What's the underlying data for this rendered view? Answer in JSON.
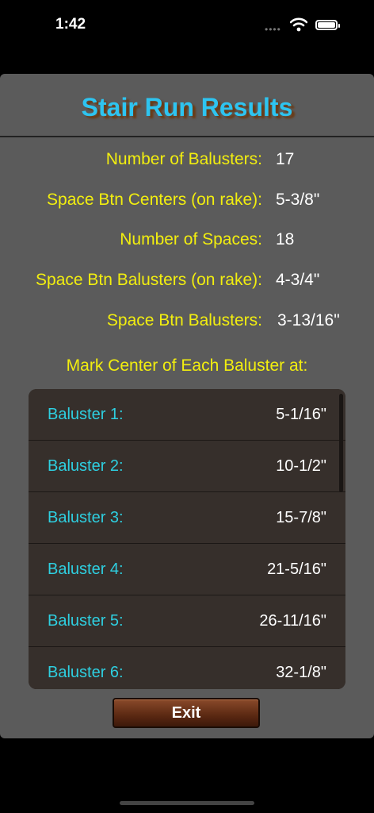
{
  "status_bar": {
    "time": "1:42",
    "dots": "••••"
  },
  "title": "Stair Run Results",
  "results": [
    {
      "label": "Number of Balusters:",
      "value": "17"
    },
    {
      "label": "Space Btn Centers (on rake):",
      "value": "5-3/8\""
    },
    {
      "label": "Number of Spaces:",
      "value": "18"
    },
    {
      "label": "Space Btn Balusters (on rake):",
      "value": "4-3/4\""
    },
    {
      "label": "Space Btn Balusters:",
      "value": "3-13/16\""
    }
  ],
  "mark_heading": "Mark Center of Each Baluster at:",
  "balusters": [
    {
      "name": "Baluster 1:",
      "value": "5-1/16\""
    },
    {
      "name": "Baluster 2:",
      "value": "10-1/2\""
    },
    {
      "name": "Baluster 3:",
      "value": "15-7/8\""
    },
    {
      "name": "Baluster 4:",
      "value": "21-5/16\""
    },
    {
      "name": "Baluster 5:",
      "value": "26-11/16\""
    },
    {
      "name": "Baluster 6:",
      "value": "32-1/8\""
    }
  ],
  "exit_label": "Exit"
}
